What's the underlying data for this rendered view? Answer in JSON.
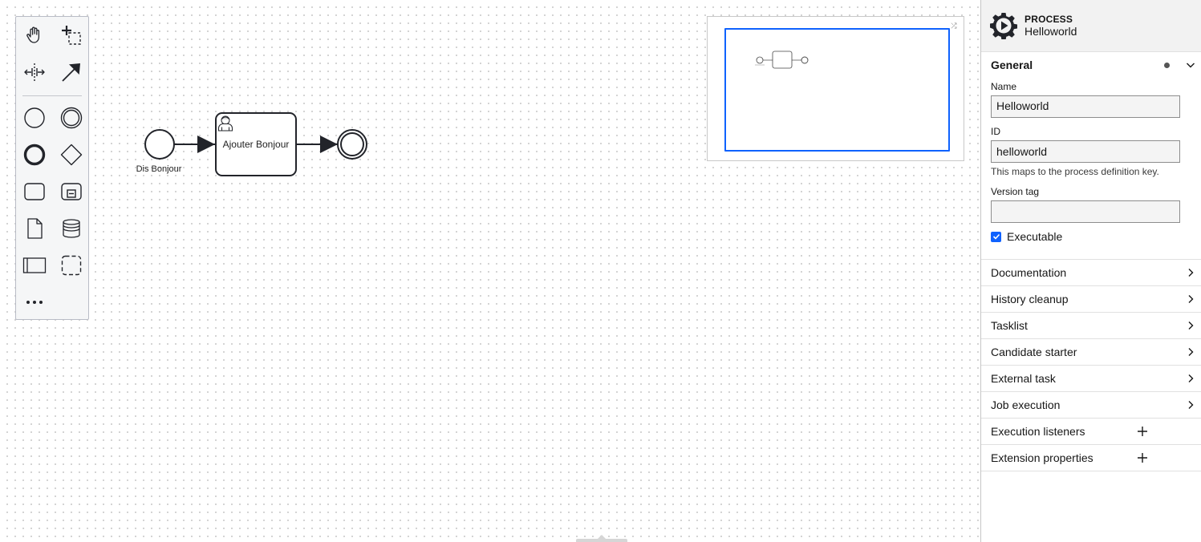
{
  "palette": {
    "tools": [
      {
        "id": "hand",
        "icon": "hand-icon"
      },
      {
        "id": "lasso",
        "icon": "lasso-icon"
      },
      {
        "id": "space",
        "icon": "space-tool-icon"
      },
      {
        "id": "connect",
        "icon": "connect-arrow-icon"
      },
      {
        "id": "start-event",
        "icon": "start-event-icon"
      },
      {
        "id": "intermediate-event",
        "icon": "intermediate-event-icon"
      },
      {
        "id": "end-event",
        "icon": "end-event-icon"
      },
      {
        "id": "gateway",
        "icon": "gateway-icon"
      },
      {
        "id": "task",
        "icon": "task-icon"
      },
      {
        "id": "subprocess",
        "icon": "subprocess-icon"
      },
      {
        "id": "data-object",
        "icon": "data-object-icon"
      },
      {
        "id": "data-store",
        "icon": "data-store-icon"
      },
      {
        "id": "pool",
        "icon": "pool-icon"
      },
      {
        "id": "group",
        "icon": "group-icon"
      },
      {
        "id": "more",
        "icon": "more-icon"
      }
    ]
  },
  "diagram": {
    "start_event_label": "Dis Bonjour",
    "task_label": "Ajouter Bonjour",
    "task_icon": "user-task-icon"
  },
  "panel": {
    "element_type": "PROCESS",
    "element_name": "Helloworld",
    "header_icon": "process-gear-icon",
    "general": {
      "title": "General",
      "name_label": "Name",
      "name_value": "Helloworld",
      "id_label": "ID",
      "id_value": "helloworld",
      "id_description": "This maps to the process definition key.",
      "version_tag_label": "Version tag",
      "version_tag_value": "",
      "executable_label": "Executable",
      "executable_checked": true
    },
    "groups": [
      {
        "title": "Documentation"
      },
      {
        "title": "History cleanup"
      },
      {
        "title": "Tasklist"
      },
      {
        "title": "Candidate starter"
      },
      {
        "title": "External task"
      },
      {
        "title": "Job execution"
      }
    ],
    "list_groups": [
      {
        "title": "Execution listeners"
      },
      {
        "title": "Extension properties"
      }
    ]
  },
  "colors": {
    "accent": "#0f62fe",
    "stroke": "#22242a"
  }
}
